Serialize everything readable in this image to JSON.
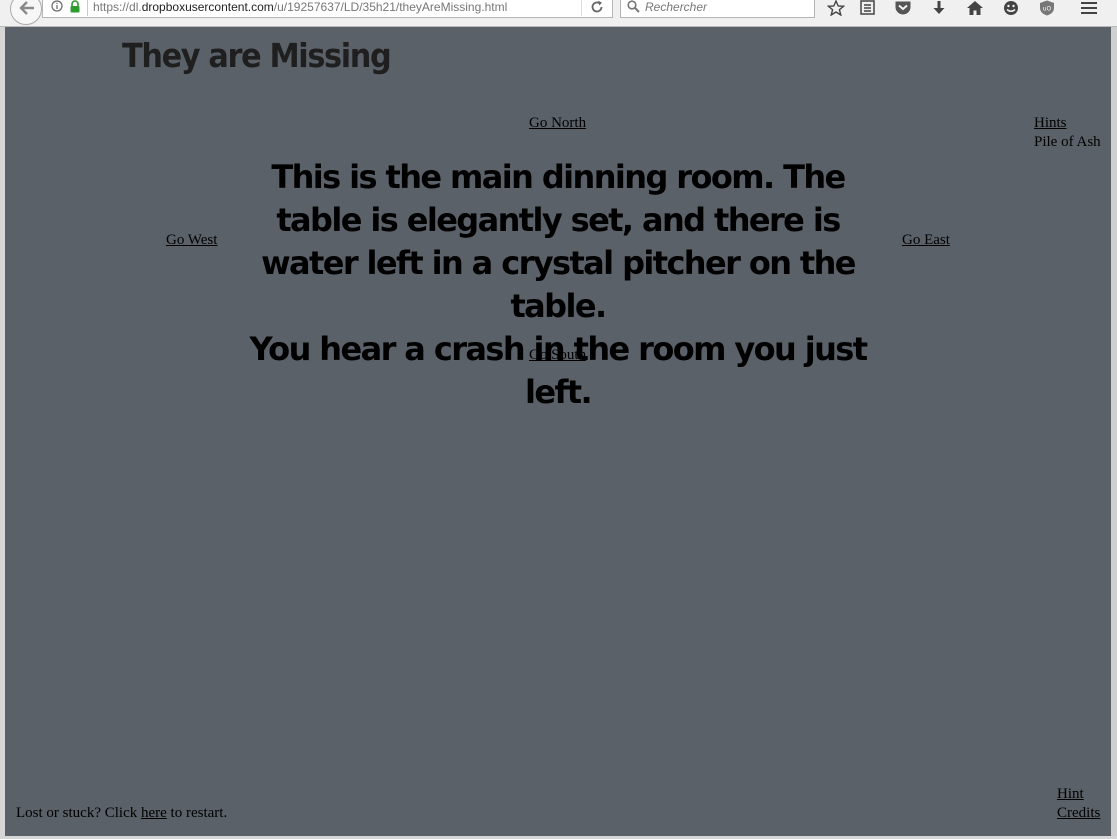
{
  "browser": {
    "url_prefix": "https://dl.",
    "url_domain": "dropboxusercontent.com",
    "url_path": "/u/19257637/LD/35h21/theyAreMissing.html",
    "search_placeholder": "Rechercher"
  },
  "page": {
    "title": "They are Missing",
    "nav": {
      "north": "Go North",
      "south": "Go South",
      "west": "Go West",
      "east": "Go East"
    },
    "sidebar": {
      "hints_label": "Hints",
      "inventory_item": "Pile of Ash"
    },
    "description": {
      "room": "This is the main dinning room. The table is elegantly set, and there is water left in a crystal pitcher on the table.",
      "event": "You hear a crash in the room you just left."
    },
    "footer": {
      "prefix": "Lost or stuck? Click ",
      "link": "here",
      "suffix": " to restart.",
      "hint_label": "Hint",
      "credits_label": "Credits"
    }
  }
}
